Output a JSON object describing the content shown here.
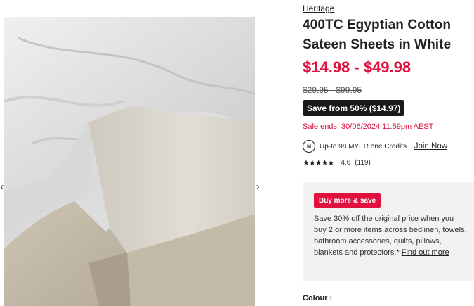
{
  "gallery": {
    "prev_icon": "chevron-left-icon",
    "next_icon": "chevron-right-icon",
    "prev_glyph": "‹",
    "next_glyph": "›"
  },
  "product": {
    "brand": "Heritage",
    "title": "400TC Egyptian Cotton Sateen Sheets in White",
    "price_range": "$14.98 - $49.98",
    "was_price": "$29.95 - $99.95",
    "save_badge": "Save from 50% ($14.97)",
    "sale_ends": "Sale ends: 30/06/2024 11:59pm AEST"
  },
  "credits": {
    "icon_glyph": "M",
    "text": "Up-to 98 MYER one Credits.",
    "join_label": "Join Now"
  },
  "rating": {
    "stars_glyph": "★★★★★",
    "value": "4.6",
    "count": "(119)",
    "stars_out_of_5": 4.6
  },
  "promo": {
    "tag": "Buy more & save",
    "text": "Save 30% off the original price when you buy 2 or more items across bedlinen, towels, bathroom accessories, quilts, pillows, blankets and protectors.*",
    "link": "Find out more"
  },
  "colour_label": "Colour :",
  "colors": {
    "accent_red": "#e0103f",
    "badge_dark": "#1a1a1a",
    "promo_bg": "#f2f2f2"
  }
}
